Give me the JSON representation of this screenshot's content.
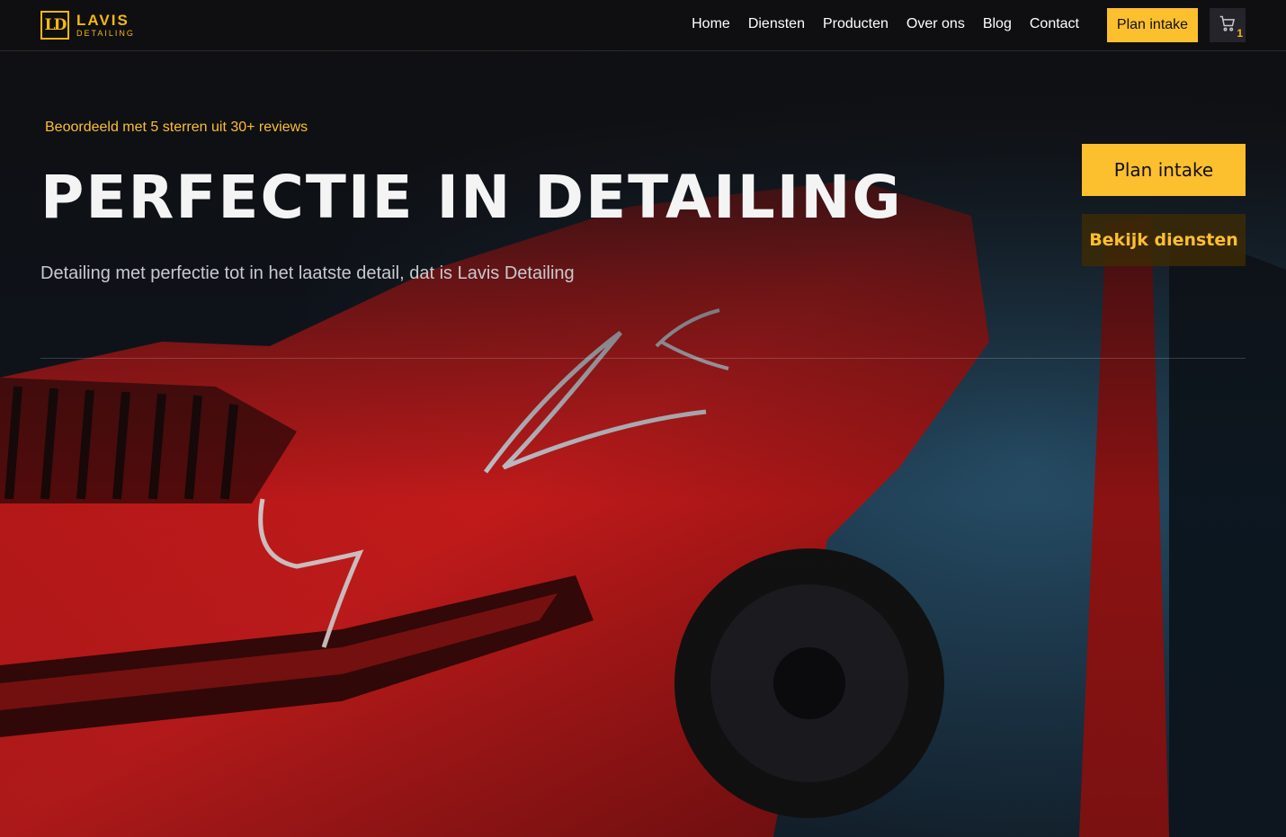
{
  "brand": {
    "mark": "LD",
    "name": "LAVIS",
    "sub": "DETAILING",
    "accent_color": "#fcbf2e"
  },
  "nav": {
    "items": [
      {
        "label": "Home"
      },
      {
        "label": "Diensten"
      },
      {
        "label": "Producten"
      },
      {
        "label": "Over ons"
      },
      {
        "label": "Blog"
      },
      {
        "label": "Contact"
      }
    ],
    "cta_label": "Plan intake",
    "cart_icon": "cart-icon",
    "cart_count": "1"
  },
  "hero": {
    "rating": "Beoordeeld met 5 sterren uit 30+ reviews",
    "title": "PERFECTIE IN DETAILING",
    "subtitle": "Detailing met perfectie tot in het laatste detail, dat is Lavis Detailing",
    "primary_button": "Plan intake",
    "secondary_button": "Bekijk diensten",
    "background_image": "red-sports-car"
  }
}
